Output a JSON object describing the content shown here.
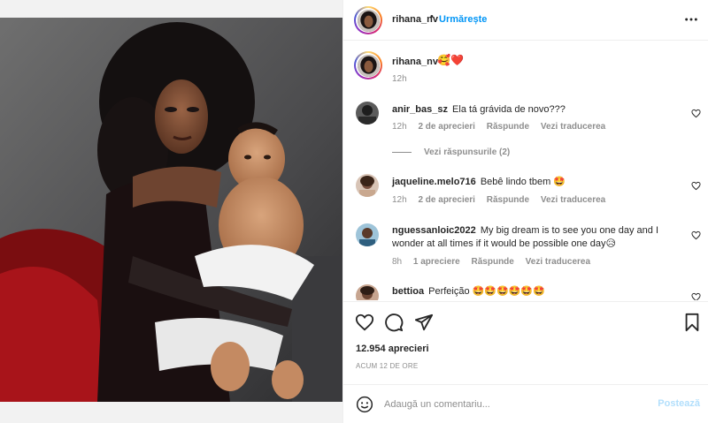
{
  "post": {
    "author": "rihana_nv",
    "follow_label": "Urmărește",
    "separator": "•",
    "caption_emoji": "🥰❤️",
    "caption_time": "12h",
    "likes": "12.954 aprecieri",
    "posted_ago": "ACUM 12 DE ORE",
    "accent_color": "#0095f6"
  },
  "comments": [
    {
      "user": "anir_bas_sz",
      "text": "Ela tá grávida de novo???",
      "time": "12h",
      "likes": "2 de aprecieri",
      "reply": "Răspunde",
      "translate": "Vezi traducerea",
      "view_replies": "Vezi răspunsurile (2)"
    },
    {
      "user": "jaqueline.melo716",
      "text": "Bebê lindo tbem 🤩",
      "time": "12h",
      "likes": "2 de aprecieri",
      "reply": "Răspunde",
      "translate": "Vezi traducerea"
    },
    {
      "user": "nguessanloic2022",
      "text": "My big dream is to see you one day and I wonder at all times if it would be possible one day😥",
      "time": "8h",
      "likes": "1 apreciere",
      "reply": "Răspunde",
      "translate": "Vezi traducerea"
    },
    {
      "user": "bettioa",
      "text": "Perfeição 🤩🤩🤩🤩🤩🤩"
    }
  ],
  "composer": {
    "placeholder": "Adaugă un comentariu...",
    "post_label": "Postează"
  },
  "icons": {
    "more": "more-horizontal-icon",
    "like": "heart-icon",
    "comment": "comment-icon",
    "share": "share-icon",
    "save": "bookmark-icon",
    "emoji": "smiley-icon"
  }
}
